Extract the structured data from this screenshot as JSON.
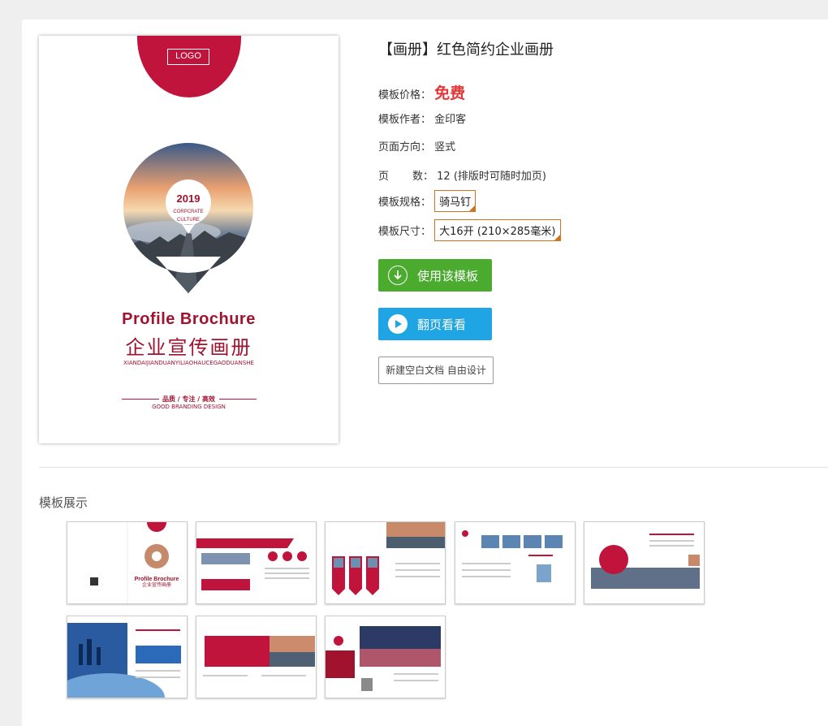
{
  "cover": {
    "logo": "LOGO",
    "year": "2019",
    "sub1": "CORPCRATE",
    "sub2": "CULTURE",
    "title_en": "Profile Brochure",
    "title_cn": "企业宣传画册",
    "pinyin": "XIANDAIJIANDUANYILIAOHAUCEGAODUANSHE",
    "tag_cn": "品质 / 专注 / 高效",
    "tag_en": "GOOD BRANDING DESIGN"
  },
  "product": {
    "title": "【画册】红色简约企业画册",
    "price_label": "模板价格：",
    "price_value": "免费",
    "author_label": "模板作者：",
    "author_value": "金印客",
    "orientation_label": "页面方向：",
    "orientation_value": "竖式",
    "pages_label_1": "页",
    "pages_label_2": "数：",
    "pages_value": "12 (排版时可随时加页)",
    "spec_label": "模板规格：",
    "spec_value": "骑马钉",
    "size_label": "模板尺寸：",
    "size_value": "大16开 (210×285毫米)"
  },
  "buttons": {
    "use": "使用该模板",
    "flip": "翻页看看",
    "new_doc": "新建空白文档 自由设计"
  },
  "gallery": {
    "title": "模板展示",
    "thumb_texts": {
      "t1_en": "Profile Brochure",
      "t1_cn": "企业宣传画册"
    }
  },
  "colors": {
    "brand_red": "#c0143c",
    "green": "#4aab2f",
    "blue": "#1fa5e3",
    "price_red": "#e63535",
    "option_border": "#d1731e"
  }
}
